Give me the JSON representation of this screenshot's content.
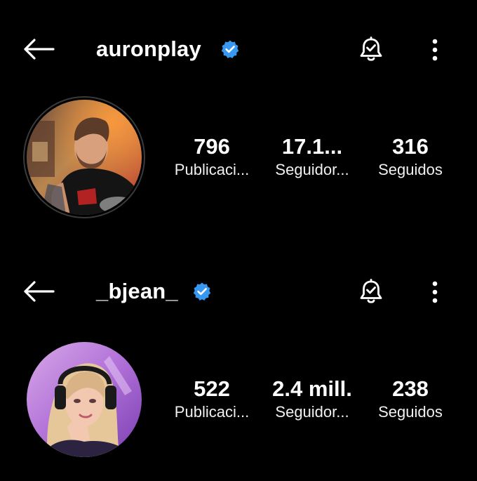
{
  "colors": {
    "background": "#000000",
    "text": "#ffffff",
    "verified_badge": "#3897f0"
  },
  "profiles": [
    {
      "username": "auronplay",
      "verified": true,
      "icons": {
        "back": "arrow-left-icon",
        "verified": "verified-badge-icon",
        "notifications": "bell-check-icon",
        "more": "more-vertical-icon"
      },
      "avatar": "profile-photo-man-red-shirt",
      "stats": [
        {
          "value": "796",
          "label": "Publicaci..."
        },
        {
          "value": "17.1...",
          "label": "Seguidor..."
        },
        {
          "value": "316",
          "label": "Seguidos"
        }
      ]
    },
    {
      "username": "_bjean_",
      "verified": true,
      "icons": {
        "back": "arrow-left-icon",
        "verified": "verified-badge-icon",
        "notifications": "bell-check-icon",
        "more": "more-vertical-icon"
      },
      "avatar": "profile-photo-woman-headset",
      "stats": [
        {
          "value": "522",
          "label": "Publicaci..."
        },
        {
          "value": "2.4 mill.",
          "label": "Seguidor..."
        },
        {
          "value": "238",
          "label": "Seguidos"
        }
      ]
    }
  ]
}
